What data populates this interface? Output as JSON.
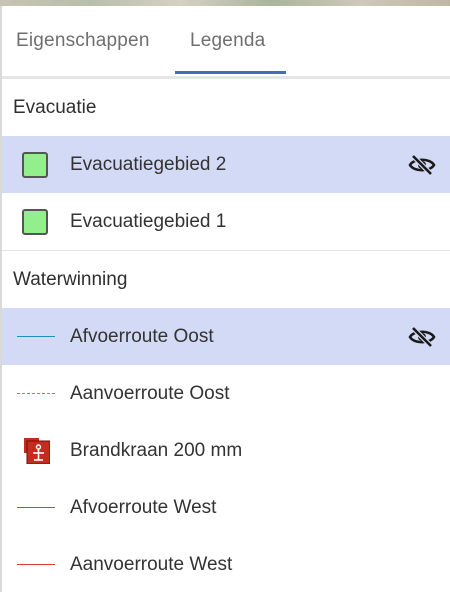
{
  "tabs": [
    {
      "label": "Eigenschappen"
    },
    {
      "label": "Legenda"
    }
  ],
  "active_tab": "Legenda",
  "sections": [
    {
      "title": "Evacuatie",
      "items": [
        {
          "label": "Evacuatiegebied 2",
          "symbol": "green-square",
          "color": "#93ef8c",
          "highlighted": true,
          "hidden_icon": "eye-off-icon"
        },
        {
          "label": "Evacuatiegebied 1",
          "symbol": "green-square",
          "color": "#93ef8c",
          "highlighted": false
        }
      ]
    },
    {
      "title": "Waterwinning",
      "items": [
        {
          "label": "Afvoerroute Oost",
          "symbol": "solid-line",
          "color": "#1f8fb8",
          "highlighted": true,
          "hidden_icon": "eye-off-icon"
        },
        {
          "label": "Aanvoerroute Oost",
          "symbol": "dashed-line",
          "color": "#4aa3c4",
          "highlighted": false
        },
        {
          "label": "Brandkraan 200 mm",
          "symbol": "hydrant-icon",
          "color": "#c62b1f",
          "highlighted": false
        },
        {
          "label": "Afvoerroute West",
          "symbol": "solid-line",
          "color": "#3d75c7",
          "highlighted": false
        },
        {
          "label": "Aanvoerroute West",
          "symbol": "solid-line",
          "color": "#e23a2a",
          "highlighted": false
        }
      ]
    }
  ],
  "colors": {
    "accent": "#3d6ec0",
    "highlight": "#d3daf5"
  }
}
